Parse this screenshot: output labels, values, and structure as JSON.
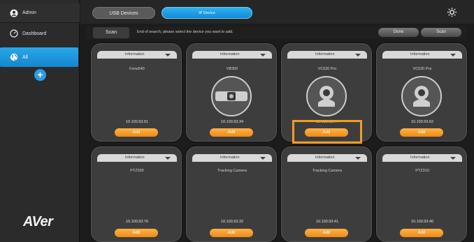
{
  "sidebar": {
    "user_label": "Admin",
    "dashboard_label": "Dashboard",
    "all_label": "All"
  },
  "brand": {
    "logo_text": "AVer"
  },
  "tabs": {
    "usb": "USB Devices",
    "ip": "IP Device"
  },
  "scanbar": {
    "scan_label": "Scan",
    "message": "End of search, please select the device you want to add.",
    "done_label": "Done",
    "scan_again_label": "Scan"
  },
  "cards": [
    {
      "info": "Information",
      "model": "Fone540",
      "ip": "10.100.93.91",
      "add": "Add",
      "icon": "none"
    },
    {
      "info": "Information",
      "model": "VB350",
      "ip": "10.100.93.34",
      "add": "Add",
      "icon": "bar-camera-icon"
    },
    {
      "info": "Information",
      "model": "VC520 Pro",
      "ip": "10.100.93.44",
      "add": "Add",
      "icon": "ptz-camera-icon"
    },
    {
      "info": "Information",
      "model": "VC520 Pro",
      "ip": "10.100.93.62",
      "add": "Add",
      "icon": "ptz-camera-icon"
    },
    {
      "info": "Information",
      "model": "PTZ330",
      "ip": "10.100.93.76",
      "add": "Add",
      "icon": "none"
    },
    {
      "info": "Information",
      "model": "Tracking Camera",
      "ip": "10.100.93.32",
      "add": "Add",
      "icon": "none"
    },
    {
      "info": "Information",
      "model": "Tracking Camera",
      "ip": "10.100.93.41",
      "add": "Add",
      "icon": "none"
    },
    {
      "info": "Information",
      "model": "PTZ310",
      "ip": "10.100.93.40",
      "add": "Add",
      "icon": "none"
    }
  ],
  "colors": {
    "accent_blue": "#1b95de",
    "add_orange": "#f39c1f",
    "highlight": "#f39c1f"
  }
}
